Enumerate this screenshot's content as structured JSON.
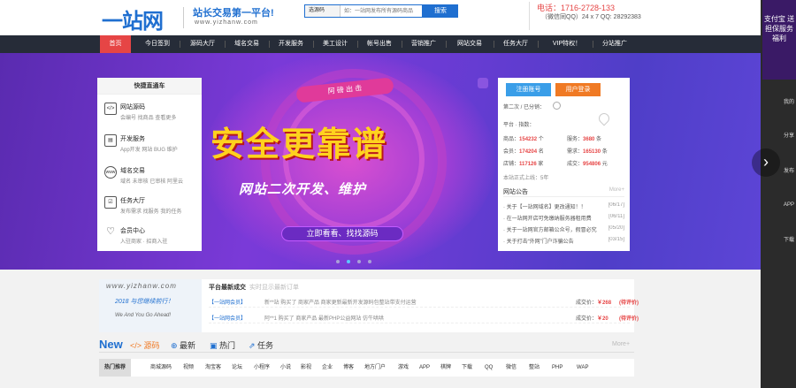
{
  "header": {
    "logo": "一站网",
    "slogan": "站长交易第一平台!",
    "slogan_url": "www.yizhanw.com",
    "search_type": "选源码",
    "search_placeholder": "如：一站网发布所有源码商品",
    "search_button": "搜索",
    "phone": "电话：1716-2728-133",
    "qq": "（微信同QQ）24 x 7 QQ: 28292383"
  },
  "nav": {
    "items": [
      {
        "label": "首页",
        "active": true
      },
      {
        "label": "今日签到",
        "active": false
      },
      {
        "label": "源码大厅",
        "active": false
      },
      {
        "label": "域名交易",
        "active": false
      },
      {
        "label": "开发服务",
        "active": false
      },
      {
        "label": "美工设计",
        "active": false
      },
      {
        "label": "帐号出售",
        "active": false
      },
      {
        "label": "营销推广",
        "active": false
      },
      {
        "label": "网站交易",
        "active": false
      },
      {
        "label": "任务大厅",
        "active": false
      },
      {
        "label": "VIP特权！",
        "active": false
      },
      {
        "label": "分站推广",
        "active": false
      }
    ]
  },
  "banner": {
    "tag": "阿 磅 出 击",
    "slogan": "安全更靠谱",
    "subtitle": "网站二次开发、维护",
    "cta": "立即看看、找找源码",
    "dots": 4,
    "active_dot": 1
  },
  "quick_panel": {
    "title": "快捷直通车",
    "items": [
      {
        "icon": "</>",
        "icon_name": "code-icon",
        "label": "网站源码",
        "subs": "会编号 找商品 查看更多"
      },
      {
        "icon": "▤",
        "icon_name": "dev-icon",
        "label": "开发服务",
        "subs": "App开发 网站 BUG 维护"
      },
      {
        "icon": "www",
        "icon_name": "domain-icon",
        "label": "域名交易",
        "subs": "域名 未审核 已审核 阿里云"
      },
      {
        "icon": "☑",
        "icon_name": "task-icon",
        "label": "任务大厅",
        "subs": "发布需求 找服务 我的任务"
      },
      {
        "icon": "♡",
        "icon_name": "member-icon",
        "label": "会员中心",
        "subs": "入驻商家 · 招商入驻"
      }
    ]
  },
  "info_panel": {
    "register": "注册账号",
    "login": "用户登录",
    "today_line": "第二次 / 已分销：",
    "platform_line": "平台 · 指数：",
    "stats": [
      {
        "label": "商品：",
        "value": "154232",
        "unit": "个"
      },
      {
        "label": "服务：",
        "value": "3680",
        "unit": "条"
      },
      {
        "label": "会员：",
        "value": "174204",
        "unit": "名"
      },
      {
        "label": "需求：",
        "value": "165130",
        "unit": "条"
      },
      {
        "label": "店铺：",
        "value": "117126",
        "unit": "家"
      },
      {
        "label": "成交：",
        "value": "954806",
        "unit": "元"
      }
    ],
    "run_line": "本站正式上线：5年",
    "notice_title": "网站公告",
    "notice_more": "More+",
    "notices": [
      {
        "text": "· 关于【一站网域名】更改通知！！",
        "date": "[06/17]"
      },
      {
        "text": "· 在一站网开店可免缴纳服务器租用费",
        "date": "[06/11]"
      },
      {
        "text": "· 关于一站网官方邮箱公众号，假冒必究",
        "date": "[05/20]"
      },
      {
        "text": "· 关于打击“外网”门户诈骗公告",
        "date": "[03/15]"
      }
    ]
  },
  "lower": {
    "url": "www.yizhanw.com",
    "slogan_cn": "2018 与您继续前行！",
    "slogan_en": "We And You Go Ahead!",
    "trade_title": "平台最新成交",
    "trade_sub": "实时显示最新订单",
    "trades": [
      {
        "user": "【一站网会员】",
        "item": "新**站 购买了 商家产品 商家更新最新开发源码包整站带支付运营",
        "cat": "成交价：",
        "price": "￥268",
        "status": "(待评价)"
      },
      {
        "user": "【一站网会员】",
        "item": "阿**1 购买了 商家产品 最新PHP公益网站 仿牛哄哄",
        "cat": "成交价：",
        "price": "￥20",
        "status": "(待评价)"
      }
    ]
  },
  "new_section": {
    "title": "New",
    "tabs": [
      "源码",
      "最新",
      "热门",
      "任务"
    ],
    "more": "More+",
    "categories": [
      "热门推荐",
      "商城源码",
      "视频",
      "淘宝客",
      "论坛",
      "小程序",
      "小说",
      "影视",
      "企业",
      "博客",
      "地方门户",
      "游戏",
      "APP",
      "棋牌",
      "下载",
      "QQ",
      "微信",
      "整站",
      "PHP",
      "WAP"
    ]
  },
  "side": {
    "top_text": "支付宝 送 担保服务 福利",
    "items": [
      "我的",
      "分享",
      "发布",
      "APP",
      "下载"
    ]
  }
}
